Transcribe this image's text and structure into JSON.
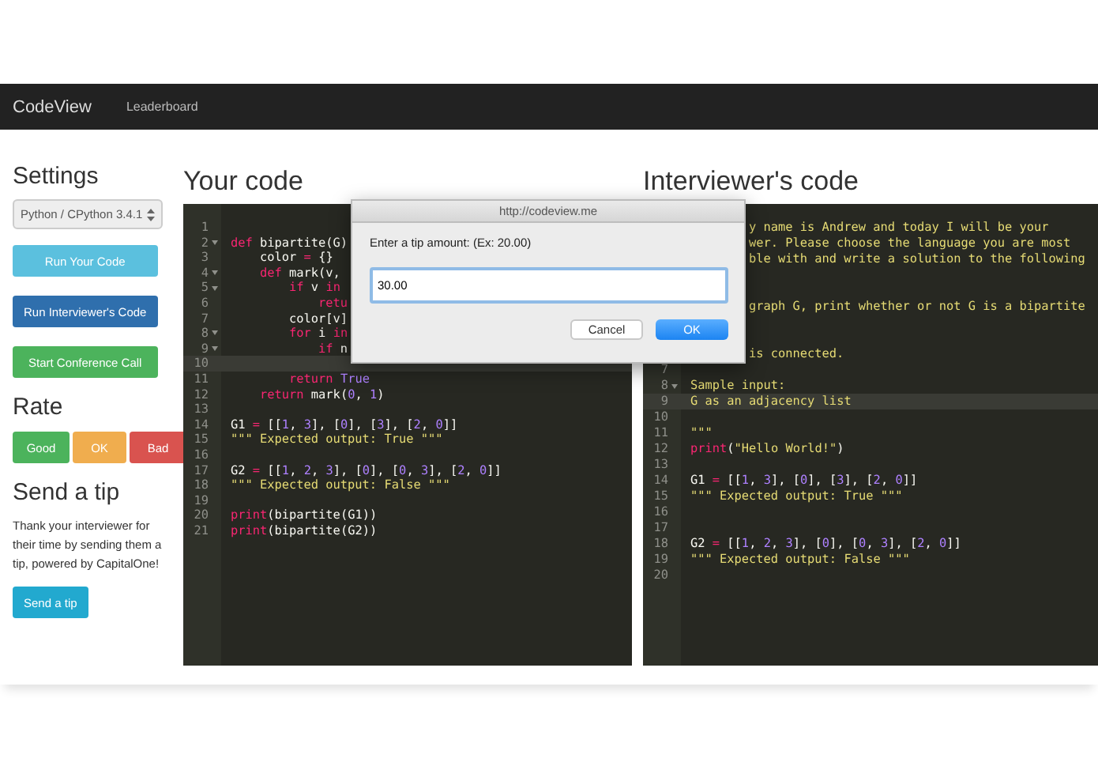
{
  "navbar": {
    "brand": "CodeView",
    "links": [
      "Leaderboard"
    ]
  },
  "sidebar": {
    "settings_heading": "Settings",
    "language_select": "Python / CPython 3.4.1",
    "actions": [
      {
        "label": "Run Your Code",
        "kind": "info"
      },
      {
        "label": "Run Interviewer's Code",
        "kind": "primary"
      },
      {
        "label": "Start Conference Call",
        "kind": "success"
      }
    ],
    "rate_heading": "Rate",
    "rate_buttons": [
      {
        "label": "Good",
        "kind": "success"
      },
      {
        "label": "OK",
        "kind": "warning"
      },
      {
        "label": "Bad",
        "kind": "danger"
      }
    ],
    "tip_heading": "Send a tip",
    "tip_text": "Thank your interviewer for their time by sending them a tip, powered by CapitalOne!",
    "tip_button": "Send a tip"
  },
  "your_code": {
    "heading": "Your code",
    "lines": [
      {
        "num": "1",
        "fold": false,
        "active": false
      },
      {
        "num": "2",
        "fold": true,
        "active": false,
        "tokens": [
          {
            "kind": "kw",
            "text": "def"
          },
          {
            "kind": "plain",
            "text": " bipartite(G)"
          }
        ]
      },
      {
        "num": "3",
        "fold": false,
        "active": false,
        "tokens": [
          {
            "kind": "plain",
            "text": "    color "
          },
          {
            "kind": "kw",
            "text": "="
          },
          {
            "kind": "plain",
            "text": " {}"
          }
        ]
      },
      {
        "num": "4",
        "fold": true,
        "active": false,
        "tokens": [
          {
            "kind": "kw",
            "text": "    def"
          },
          {
            "kind": "plain",
            "text": " mark(v,"
          }
        ]
      },
      {
        "num": "5",
        "fold": true,
        "active": false,
        "tokens": [
          {
            "kind": "kw",
            "text": "        if"
          },
          {
            "kind": "plain",
            "text": " v "
          },
          {
            "kind": "kw",
            "text": "in"
          }
        ]
      },
      {
        "num": "6",
        "fold": false,
        "active": false,
        "tokens": [
          {
            "kind": "kw",
            "text": "            retu"
          }
        ]
      },
      {
        "num": "7",
        "fold": false,
        "active": false,
        "tokens": [
          {
            "kind": "plain",
            "text": "        color[v]"
          }
        ]
      },
      {
        "num": "8",
        "fold": true,
        "active": false,
        "tokens": [
          {
            "kind": "kw",
            "text": "        for"
          },
          {
            "kind": "plain",
            "text": " i "
          },
          {
            "kind": "kw",
            "text": "in"
          }
        ]
      },
      {
        "num": "9",
        "fold": true,
        "active": false,
        "tokens": [
          {
            "kind": "kw",
            "text": "            if"
          },
          {
            "kind": "plain",
            "text": " n"
          }
        ]
      },
      {
        "num": "10",
        "fold": false,
        "active": true
      },
      {
        "num": "11",
        "fold": false,
        "active": false,
        "tokens": [
          {
            "kind": "kw",
            "text": "        return "
          },
          {
            "kind": "num",
            "text": "True"
          }
        ]
      },
      {
        "num": "12",
        "fold": false,
        "active": false,
        "tokens": [
          {
            "kind": "kw",
            "text": "    return"
          },
          {
            "kind": "plain",
            "text": " mark("
          },
          {
            "kind": "num",
            "text": "0"
          },
          {
            "kind": "plain",
            "text": ", "
          },
          {
            "kind": "num",
            "text": "1"
          },
          {
            "kind": "plain",
            "text": ")"
          }
        ]
      },
      {
        "num": "13",
        "fold": false,
        "active": false
      },
      {
        "num": "14",
        "fold": false,
        "active": false,
        "tokens": [
          {
            "kind": "plain",
            "text": "G1 "
          },
          {
            "kind": "kw",
            "text": "="
          },
          {
            "kind": "plain",
            "text": " [["
          },
          {
            "kind": "num",
            "text": "1"
          },
          {
            "kind": "plain",
            "text": ", "
          },
          {
            "kind": "num",
            "text": "3"
          },
          {
            "kind": "plain",
            "text": "], ["
          },
          {
            "kind": "num",
            "text": "0"
          },
          {
            "kind": "plain",
            "text": "], ["
          },
          {
            "kind": "num",
            "text": "3"
          },
          {
            "kind": "plain",
            "text": "], ["
          },
          {
            "kind": "num",
            "text": "2"
          },
          {
            "kind": "plain",
            "text": ", "
          },
          {
            "kind": "num",
            "text": "0"
          },
          {
            "kind": "plain",
            "text": "]]"
          }
        ]
      },
      {
        "num": "15",
        "fold": false,
        "active": false,
        "tokens": [
          {
            "kind": "str",
            "text": "\"\"\" Expected output: True \"\"\""
          }
        ]
      },
      {
        "num": "16",
        "fold": false,
        "active": false
      },
      {
        "num": "17",
        "fold": false,
        "active": false,
        "tokens": [
          {
            "kind": "plain",
            "text": "G2 "
          },
          {
            "kind": "kw",
            "text": "="
          },
          {
            "kind": "plain",
            "text": " [["
          },
          {
            "kind": "num",
            "text": "1"
          },
          {
            "kind": "plain",
            "text": ", "
          },
          {
            "kind": "num",
            "text": "2"
          },
          {
            "kind": "plain",
            "text": ", "
          },
          {
            "kind": "num",
            "text": "3"
          },
          {
            "kind": "plain",
            "text": "], ["
          },
          {
            "kind": "num",
            "text": "0"
          },
          {
            "kind": "plain",
            "text": "], ["
          },
          {
            "kind": "num",
            "text": "0"
          },
          {
            "kind": "plain",
            "text": ", "
          },
          {
            "kind": "num",
            "text": "3"
          },
          {
            "kind": "plain",
            "text": "], ["
          },
          {
            "kind": "num",
            "text": "2"
          },
          {
            "kind": "plain",
            "text": ", "
          },
          {
            "kind": "num",
            "text": "0"
          },
          {
            "kind": "plain",
            "text": "]]"
          }
        ]
      },
      {
        "num": "18",
        "fold": false,
        "active": false,
        "tokens": [
          {
            "kind": "str",
            "text": "\"\"\" Expected output: False \"\"\""
          }
        ]
      },
      {
        "num": "19",
        "fold": false,
        "active": false
      },
      {
        "num": "20",
        "fold": false,
        "active": false,
        "tokens": [
          {
            "kind": "kw",
            "text": "print"
          },
          {
            "kind": "plain",
            "text": "(bipartite(G1))"
          }
        ]
      },
      {
        "num": "21",
        "fold": false,
        "active": false,
        "tokens": [
          {
            "kind": "kw",
            "text": "print"
          },
          {
            "kind": "plain",
            "text": "(bipartite(G2))"
          }
        ]
      }
    ]
  },
  "interviewer_code": {
    "heading": "Interviewer's code",
    "lines": [
      {
        "kind": "covered",
        "tokens": [
          {
            "kind": "str",
            "text": "y name is Andrew and today I will be your"
          }
        ]
      },
      {
        "kind": "covered",
        "tokens": [
          {
            "kind": "str",
            "text": "wer. Please choose the language you are most"
          }
        ]
      },
      {
        "kind": "covered",
        "tokens": [
          {
            "kind": "str",
            "text": "ble with and write a solution to the following"
          }
        ]
      },
      {
        "kind": "covered"
      },
      {
        "kind": "covered"
      },
      {
        "kind": "covered",
        "tokens": [
          {
            "kind": "str",
            "text": "graph G, print whether or not G is a bipartite"
          }
        ]
      },
      {
        "kind": "covered"
      },
      {
        "kind": "covered"
      },
      {
        "kind": "covered",
        "tokens": [
          {
            "kind": "str",
            "text": "is connected."
          }
        ]
      },
      {
        "kind": "line",
        "num": "7",
        "fold": false,
        "active": false
      },
      {
        "kind": "line",
        "num": "8",
        "fold": true,
        "active": false,
        "tokens": [
          {
            "kind": "str",
            "text": "Sample input:"
          }
        ]
      },
      {
        "kind": "line",
        "num": "9",
        "fold": false,
        "active": true,
        "tokens": [
          {
            "kind": "str",
            "text": "G as an adjacency list"
          }
        ]
      },
      {
        "kind": "line",
        "num": "10",
        "fold": false,
        "active": false
      },
      {
        "kind": "line",
        "num": "11",
        "fold": false,
        "active": false,
        "tokens": [
          {
            "kind": "str",
            "text": "\"\"\""
          }
        ]
      },
      {
        "kind": "line",
        "num": "12",
        "fold": false,
        "active": false,
        "tokens": [
          {
            "kind": "kw",
            "text": "print"
          },
          {
            "kind": "plain",
            "text": "("
          },
          {
            "kind": "str",
            "text": "\"Hello World!\""
          },
          {
            "kind": "plain",
            "text": ")"
          }
        ]
      },
      {
        "kind": "line",
        "num": "13",
        "fold": false,
        "active": false
      },
      {
        "kind": "line",
        "num": "14",
        "fold": false,
        "active": false,
        "tokens": [
          {
            "kind": "plain",
            "text": "G1 "
          },
          {
            "kind": "kw",
            "text": "="
          },
          {
            "kind": "plain",
            "text": " [["
          },
          {
            "kind": "num",
            "text": "1"
          },
          {
            "kind": "plain",
            "text": ", "
          },
          {
            "kind": "num",
            "text": "3"
          },
          {
            "kind": "plain",
            "text": "], ["
          },
          {
            "kind": "num",
            "text": "0"
          },
          {
            "kind": "plain",
            "text": "], ["
          },
          {
            "kind": "num",
            "text": "3"
          },
          {
            "kind": "plain",
            "text": "], ["
          },
          {
            "kind": "num",
            "text": "2"
          },
          {
            "kind": "plain",
            "text": ", "
          },
          {
            "kind": "num",
            "text": "0"
          },
          {
            "kind": "plain",
            "text": "]]"
          }
        ]
      },
      {
        "kind": "line",
        "num": "15",
        "fold": false,
        "active": false,
        "tokens": [
          {
            "kind": "str",
            "text": "\"\"\" Expected output: True \"\"\""
          }
        ]
      },
      {
        "kind": "line",
        "num": "16",
        "fold": false,
        "active": false
      },
      {
        "kind": "line",
        "num": "17",
        "fold": false,
        "active": false
      },
      {
        "kind": "line",
        "num": "18",
        "fold": false,
        "active": false,
        "tokens": [
          {
            "kind": "plain",
            "text": "G2 "
          },
          {
            "kind": "kw",
            "text": "="
          },
          {
            "kind": "plain",
            "text": " [["
          },
          {
            "kind": "num",
            "text": "1"
          },
          {
            "kind": "plain",
            "text": ", "
          },
          {
            "kind": "num",
            "text": "2"
          },
          {
            "kind": "plain",
            "text": ", "
          },
          {
            "kind": "num",
            "text": "3"
          },
          {
            "kind": "plain",
            "text": "], ["
          },
          {
            "kind": "num",
            "text": "0"
          },
          {
            "kind": "plain",
            "text": "], ["
          },
          {
            "kind": "num",
            "text": "0"
          },
          {
            "kind": "plain",
            "text": ", "
          },
          {
            "kind": "num",
            "text": "3"
          },
          {
            "kind": "plain",
            "text": "], ["
          },
          {
            "kind": "num",
            "text": "2"
          },
          {
            "kind": "plain",
            "text": ", "
          },
          {
            "kind": "num",
            "text": "0"
          },
          {
            "kind": "plain",
            "text": "]]"
          }
        ]
      },
      {
        "kind": "line",
        "num": "19",
        "fold": false,
        "active": false,
        "tokens": [
          {
            "kind": "str",
            "text": "\"\"\" Expected output: False \"\"\""
          }
        ]
      },
      {
        "kind": "line",
        "num": "20",
        "fold": false,
        "active": false
      }
    ]
  },
  "dialog": {
    "title": "http://codeview.me",
    "prompt": "Enter a tip amount: (Ex: 20.00)",
    "value": "30.00",
    "buttons": [
      {
        "label": "Cancel",
        "kind": "default"
      },
      {
        "label": "OK",
        "kind": "primary"
      }
    ]
  }
}
